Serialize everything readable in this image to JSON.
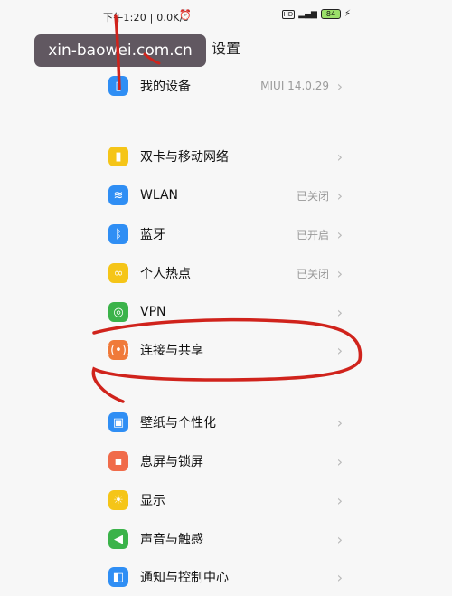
{
  "status_bar": {
    "time_speed": "下午1:20 | 0.0K/s",
    "icons": [
      "alarm-off-icon",
      "clock-icon",
      "hd-icon",
      "signal-icon",
      "battery-icon",
      "charging-icon"
    ],
    "battery_level": "84"
  },
  "watermark": "xin-baowei.com.cn",
  "page_title": "设置",
  "items": [
    {
      "label": "我的设备",
      "value": "MIUI 14.0.29",
      "icon": "device-icon",
      "color": "#2f8ef4"
    },
    {
      "label": "双卡与移动网络",
      "value": "",
      "icon": "sim-icon",
      "color": "#f5c518"
    },
    {
      "label": "WLAN",
      "value": "已关闭",
      "icon": "wifi-icon",
      "color": "#2f8ef4"
    },
    {
      "label": "蓝牙",
      "value": "已开启",
      "icon": "bluetooth-icon",
      "color": "#2f8ef4"
    },
    {
      "label": "个人热点",
      "value": "已关闭",
      "icon": "hotspot-icon",
      "color": "#f5c518"
    },
    {
      "label": "VPN",
      "value": "",
      "icon": "vpn-icon",
      "color": "#3bb34a"
    },
    {
      "label": "连接与共享",
      "value": "",
      "icon": "share-icon",
      "color": "#f07a3a"
    },
    {
      "label": "壁纸与个性化",
      "value": "",
      "icon": "wallpaper-icon",
      "color": "#2f8ef4"
    },
    {
      "label": "息屏与锁屏",
      "value": "",
      "icon": "lock-icon",
      "color": "#f06b4a"
    },
    {
      "label": "显示",
      "value": "",
      "icon": "display-icon",
      "color": "#f5c518"
    },
    {
      "label": "声音与触感",
      "value": "",
      "icon": "sound-icon",
      "color": "#3bb34a"
    },
    {
      "label": "通知与控制中心",
      "value": "",
      "icon": "notification-icon",
      "color": "#2f8ef4"
    }
  ]
}
